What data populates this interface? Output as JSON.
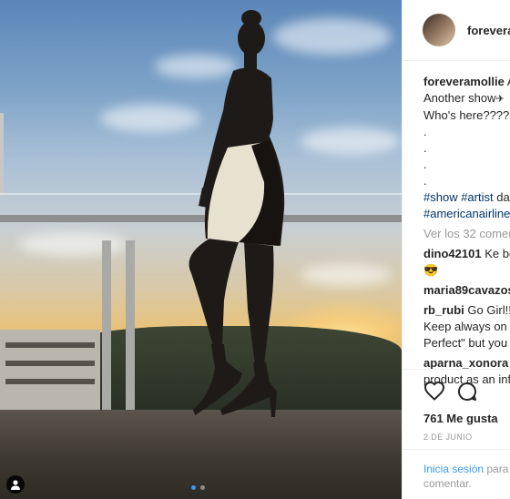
{
  "post": {
    "username": "forevera",
    "caption": {
      "username": "foreveramollie",
      "text_line1": "A",
      "text_line2": "Another show",
      "text_line3": "Who's here?????",
      "dots": [
        ".",
        ".",
        ".",
        "."
      ],
      "hashtags_line1": [
        "#show",
        "#artist",
        "da"
      ],
      "hashtags_line2": "#americanairline"
    },
    "view_comments": "Ver los 32 comen",
    "comments": [
      {
        "user": "dino42101",
        "text": "Ke bo",
        "line2": "😎"
      },
      {
        "user": "maria89cavazos",
        "text": ""
      },
      {
        "user": "rb_rubi",
        "text": "Go Girl!!",
        "line2": "Keep always on n",
        "line3": "Perfect\" but you"
      },
      {
        "user": "aparna_xonora",
        "text": "I",
        "line2": "product as an inf"
      }
    ],
    "likes": "761 Me gusta",
    "date": "2 DE JUNIO",
    "login": {
      "link": "Inicia sesión",
      "text": " para",
      "line2": "comentar."
    }
  },
  "icons": {
    "like": "heart-icon",
    "comment": "comment-icon",
    "profile_badge": "user-icon"
  },
  "carousel": {
    "count": 2,
    "active_index": 0
  },
  "colors": {
    "link": "#3897f0",
    "hashtag": "#003569",
    "muted": "#999999",
    "text": "#262626"
  }
}
